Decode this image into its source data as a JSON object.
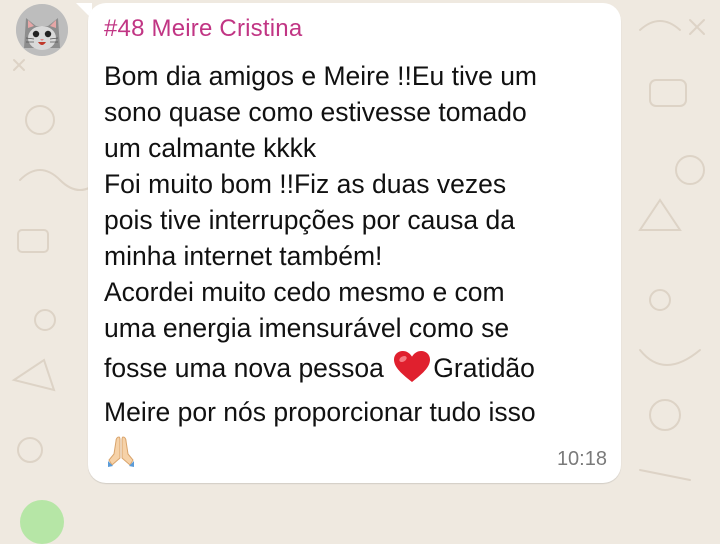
{
  "message": {
    "sender_index": "#48",
    "sender_name": "Meire Cristina",
    "lines": [
      "Bom dia amigos e Meire !!Eu tive um",
      "sono quase como estivesse tomado",
      "um calmante kkkk",
      "Foi muito bom !!Fiz as duas vezes",
      "pois tive interrupções por causa da",
      "minha internet também!",
      "Acordei muito cedo mesmo e com",
      "uma energia imensurável como se"
    ],
    "line_heart_before": "fosse uma nova pessoa ",
    "line_heart_after": "Gratidão",
    "line_last": "Meire por nós proporcionar tudo isso",
    "time": "10:18"
  },
  "icons": {
    "avatar": "cat-avatar-icon",
    "heart": "red-heart-icon",
    "pray": "folded-hands-icon"
  },
  "colors": {
    "background": "#efe9e0",
    "bubble": "#ffffff",
    "sender": "#c13584",
    "text": "#111111",
    "time": "#7a7a7a",
    "heart": "#e0202e"
  }
}
